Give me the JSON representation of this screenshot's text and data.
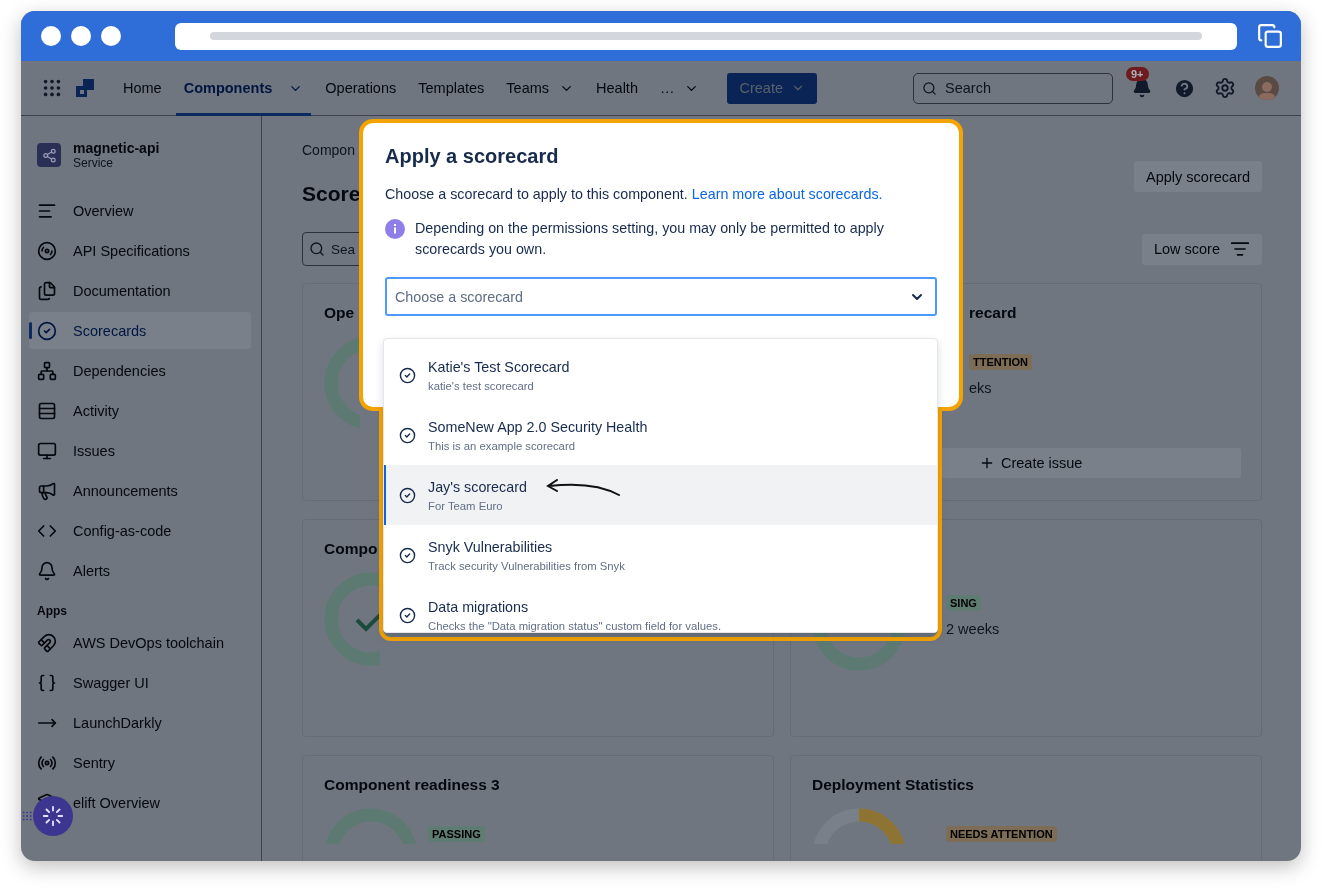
{
  "nav": {
    "items": [
      {
        "label": "Home",
        "selected": false,
        "dropdown": false
      },
      {
        "label": "Components",
        "selected": true,
        "dropdown": true
      },
      {
        "label": "Operations",
        "selected": false,
        "dropdown": false
      },
      {
        "label": "Templates",
        "selected": false,
        "dropdown": false
      },
      {
        "label": "Teams",
        "selected": false,
        "dropdown": true
      },
      {
        "label": "Health",
        "selected": false,
        "dropdown": false
      },
      {
        "label": "…",
        "selected": false,
        "dropdown": true
      }
    ],
    "create": "Create",
    "search": {
      "placeholder": "Search"
    },
    "notifications_badge": "9+"
  },
  "sidebar": {
    "component": {
      "name": "magnetic-api",
      "type": "Service"
    },
    "items": [
      {
        "label": "Overview",
        "selected": false
      },
      {
        "label": "API Specifications",
        "selected": false
      },
      {
        "label": "Documentation",
        "selected": false
      },
      {
        "label": "Scorecards",
        "selected": true
      },
      {
        "label": "Dependencies",
        "selected": false
      },
      {
        "label": "Activity",
        "selected": false
      },
      {
        "label": "Issues",
        "selected": false
      },
      {
        "label": "Announcements",
        "selected": false
      },
      {
        "label": "Config-as-code",
        "selected": false
      },
      {
        "label": "Alerts",
        "selected": false
      }
    ],
    "apps_heading": "Apps",
    "apps": [
      {
        "label": "AWS DevOps toolchain"
      },
      {
        "label": "Swagger UI"
      },
      {
        "label": "LaunchDarkly"
      },
      {
        "label": "Sentry"
      },
      {
        "label": "elift Overview"
      }
    ]
  },
  "main": {
    "breadcrumb": "Compon",
    "heading": "Score",
    "apply_button": "Apply scorecard",
    "search": {
      "placeholder": "Sea"
    },
    "sort_button": "Low score",
    "cards": [
      {
        "title": "Ope",
        "kind": "ring"
      },
      {
        "title": "recard",
        "badge": {
          "label": "TTENTION",
          "color": "#7d6c56"
        },
        "detail": "eks",
        "button": "Create issue",
        "kind": "text"
      },
      {
        "title": "Compo",
        "kind": "ring-check"
      },
      {
        "badge": {
          "label": "SING",
          "color": "#5f7c73"
        },
        "detail": "2 weeks",
        "kind": "ring"
      },
      {
        "title": "Component readiness 3",
        "badge": {
          "label": "PASSING",
          "color": "#5f7c73"
        },
        "kind": "ring"
      },
      {
        "title": "Deployment Statistics",
        "badge": {
          "label": "NEEDS ATTENTION",
          "color": "#7d6c56"
        },
        "kind": "ring-partial"
      }
    ]
  },
  "modal": {
    "title": "Apply a scorecard",
    "description": "Choose a scorecard to apply to this component.",
    "link": "Learn more about scorecards.",
    "info": "Depending on the permissions setting, you may only be permitted to apply scorecards you own.",
    "select": {
      "placeholder": "Choose a scorecard"
    },
    "options": [
      {
        "name": "Katie's Test Scorecard",
        "description": "katie's test scorecard",
        "selected": false
      },
      {
        "name": "SomeNew App 2.0 Security Health",
        "description": "This is an example scorecard",
        "selected": false
      },
      {
        "name": "Jay's scorecard",
        "description": "For Team Euro",
        "selected": true
      },
      {
        "name": "Snyk Vulnerabilities",
        "description": "Track security Vulnerabilities from Snyk",
        "selected": false
      },
      {
        "name": "Data migrations",
        "description": "Checks the \"Data migration status\" custom field for values.",
        "selected": false
      }
    ]
  }
}
